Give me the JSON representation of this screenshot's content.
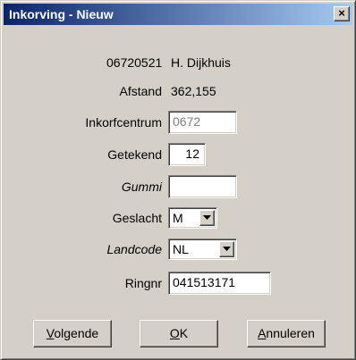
{
  "window": {
    "title": "Inkorving - Nieuw",
    "close_glyph": "×"
  },
  "record": {
    "id": "06720521",
    "name": "H. Dijkhuis"
  },
  "form": {
    "afstand_label": "Afstand",
    "afstand_value": "362,155",
    "inkorfcentrum_label": "Inkorfcentrum",
    "inkorfcentrum_value": "0672",
    "getekend_label": "Getekend",
    "getekend_value": "12",
    "gummi_label": "Gummi",
    "gummi_value": "",
    "geslacht_label": "Geslacht",
    "geslacht_value": "M",
    "landcode_label": "Landcode",
    "landcode_value": "NL",
    "ringnr_label": "Ringnr",
    "ringnr_value": "041513171"
  },
  "buttons": {
    "volgende_mnemonic": "V",
    "volgende_rest": "olgende",
    "ok_mnemonic": "O",
    "ok_rest": "K",
    "annuleren_mnemonic": "A",
    "annuleren_rest": "nnuleren"
  },
  "colors": {
    "titlebar_start": "#0a246a",
    "titlebar_end": "#a6caf0",
    "dialog_face": "#d4d0c8",
    "disabled_text": "#808080"
  }
}
